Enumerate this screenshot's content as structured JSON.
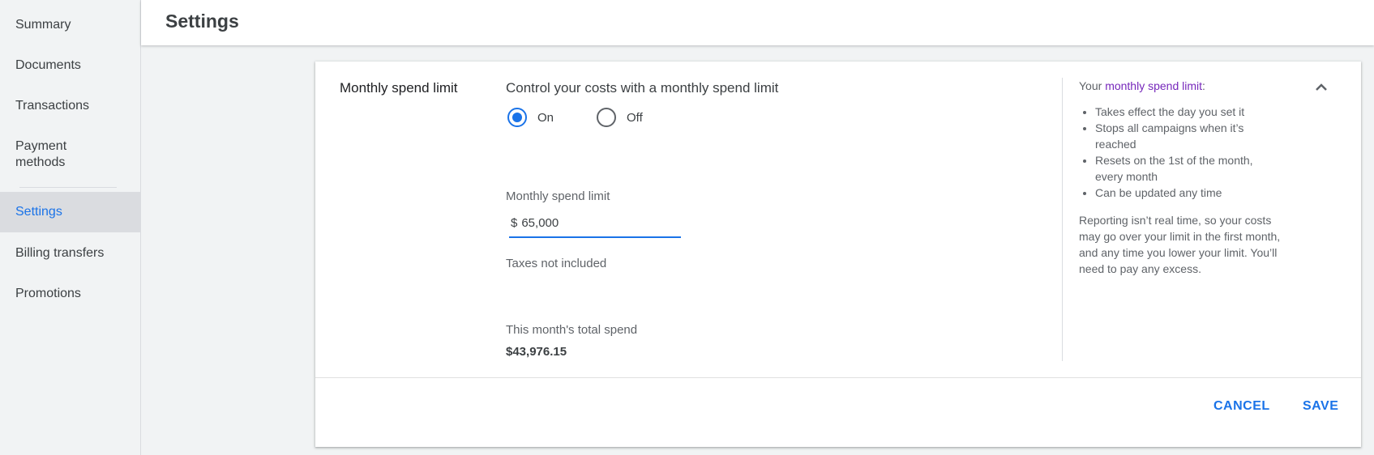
{
  "sidebar": {
    "items": [
      {
        "label": "Summary"
      },
      {
        "label": "Documents"
      },
      {
        "label": "Transactions"
      },
      {
        "label": "Payment methods"
      },
      {
        "label": "Settings"
      },
      {
        "label": "Billing transfers"
      },
      {
        "label": "Promotions"
      }
    ],
    "active_index": 4
  },
  "header": {
    "title": "Settings"
  },
  "spend_limit": {
    "section_label": "Monthly spend limit",
    "control_title": "Control your costs with a monthly spend limit",
    "options": [
      {
        "label": "On",
        "selected": true
      },
      {
        "label": "Off",
        "selected": false
      }
    ],
    "field_label": "Monthly spend limit",
    "currency_symbol": "$",
    "amount_value": "65,000",
    "tax_note": "Taxes not included",
    "total_spend_label": "This month's total spend",
    "total_spend_value": "$43,976.15"
  },
  "info": {
    "heading_prefix": "Your ",
    "heading_link": "monthly spend limit",
    "heading_suffix": ":",
    "bullets": [
      "Takes effect the day you set it",
      "Stops all campaigns when it’s reached",
      "Resets on the 1st of the month, every month",
      "Can be updated any time"
    ],
    "note": "Reporting isn’t real time, so your costs may go over your limit in the first month, and any time you lower your limit. You’ll need to pay any excess."
  },
  "actions": {
    "cancel_label": "CANCEL",
    "save_label": "SAVE"
  },
  "colors": {
    "accent": "#1a73e8",
    "link": "#7627bb",
    "sidebar_active_bg": "#dadce0"
  },
  "icons": {
    "collapse": "chevron-up-icon"
  }
}
